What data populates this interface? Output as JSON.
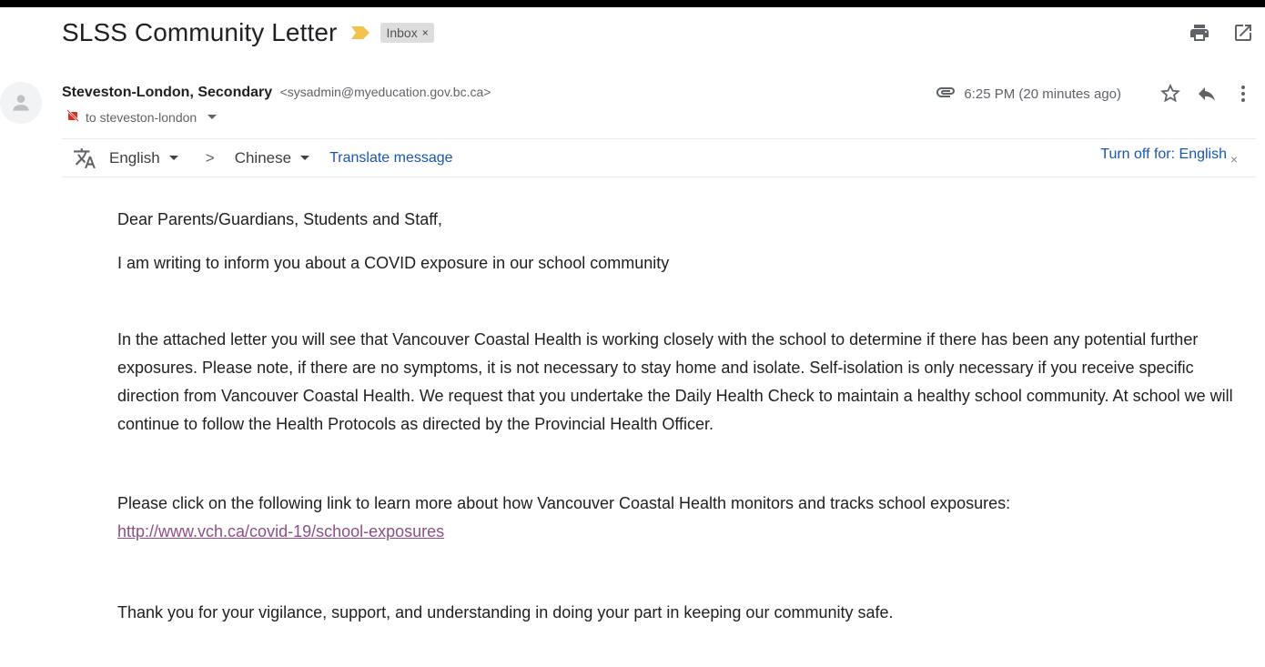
{
  "email": {
    "subject": "SLSS Community Letter",
    "label": "Inbox",
    "label_close": "×",
    "sender_name": "Steveston-London, Secondary",
    "sender_email": "<sysadmin@myeducation.gov.bc.ca>",
    "to": "to steveston-london",
    "timestamp": "6:25 PM (20 minutes ago)"
  },
  "icons": {
    "top": [
      "print-icon",
      "open-in-new-window-icon"
    ],
    "meta": [
      "attachment-icon",
      "star-icon",
      "reply-icon",
      "more-vert-icon"
    ]
  },
  "translate": {
    "from_lang": "English",
    "arrow": ">",
    "to_lang": "Chinese",
    "action": "Translate message",
    "turn_off": "Turn off for: English",
    "close": "×"
  },
  "body": {
    "greeting": "Dear Parents/Guardians, Students and Staff,",
    "intro": "I am writing to inform you about a COVID exposure in our school community",
    "para1": "In the attached letter you will see that Vancouver Coastal Health is working closely with the school to determine if there has been any potential further exposures. Please note, if there are no symptoms, it is not necessary to stay home and isolate. Self-isolation is only necessary if you receive specific direction from Vancouver Coastal Health.  We request that you undertake the Daily Health Check to maintain a healthy school community. At school we will continue to follow the Health Protocols as directed by the Provincial Health Officer.",
    "para2_text": "Please click on the following link to learn more about how Vancouver Coastal Health monitors and tracks school exposures: ",
    "para2_link": "http://www.vch.ca/covid-19/school-exposures",
    "thanks": "Thank you for your vigilance, support, and understanding in doing your part in keeping our community safe."
  },
  "colors": {
    "link_visited": "#8e4f86",
    "translate_link": "#1a55b3",
    "importance_marker": "#f2c14e"
  }
}
